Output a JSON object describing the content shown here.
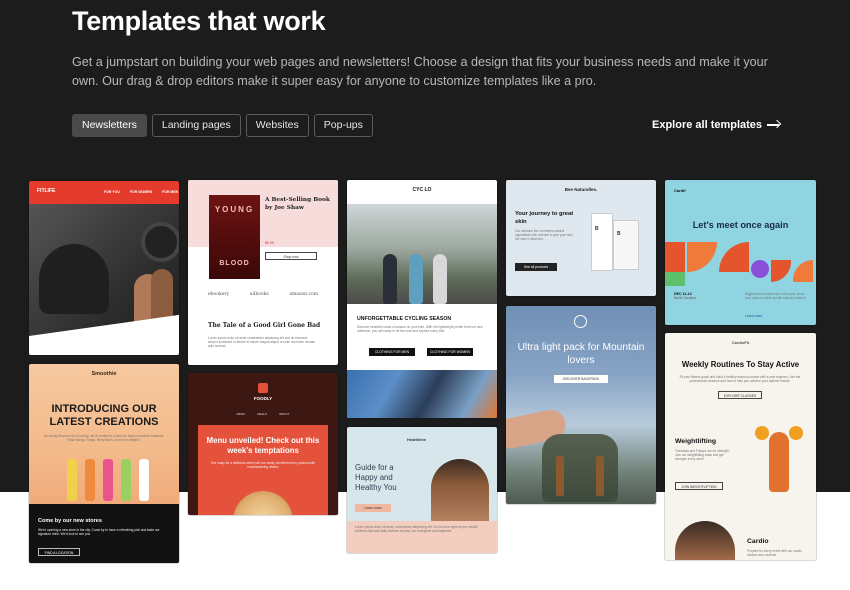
{
  "header": {
    "title": "Templates that work",
    "description": "Get a jumpstart on building your web pages and newsletters! Choose a design that fits your business needs and make it your own. Our drag & drop editors make it super easy for anyone to customize templates like a pro."
  },
  "tabs": [
    {
      "label": "Newsletters",
      "active": true
    },
    {
      "label": "Landing pages",
      "active": false
    },
    {
      "label": "Websites",
      "active": false
    },
    {
      "label": "Pop-ups",
      "active": false
    }
  ],
  "explore_link": "Explore all templates",
  "templates": {
    "fitlife": {
      "brand": "FITLIFE",
      "nav": [
        "FOR YOU",
        "FOR WOMEN",
        "FOR MEN"
      ]
    },
    "smoothie": {
      "brand": "Smoothie",
      "headline": "INTRODUCING OUR LATEST CREATIONS",
      "body": "As spring blooms into full swing, we're excited to unveil our latest smoothie creations: Rose Mango Tango, Berry Bash, and more delights.",
      "footer_title": "Come by our new stores",
      "footer_body": "We're opening a new store in the city. Come by to have a refreshing pick and taste our signature drink. We'd love to see you.",
      "button": "FIND A LOCATION"
    },
    "book": {
      "cover_top": "YOUNG",
      "cover_bottom": "BLOOD",
      "title": "A Best-Selling Book by Joe Shaw",
      "price": "$9.99",
      "button": "Shop now",
      "retailers": [
        "ebookery",
        "alibooks",
        "amazon.com"
      ],
      "section_title": "The Tale of a Good Girl Gone Bad",
      "body": "Lorem ipsum dolor sit amet consectetur adipiscing elit sed do eiusmod tempor incididunt ut labore et dolore magna aliqua ut enim ad minim veniam quis nostrud."
    },
    "foodly": {
      "brand": "FOODLY",
      "nav": [
        "MENU",
        "DEALS",
        "ABOUT"
      ],
      "headline": "Menu unveiled! Check out this week's temptations",
      "body": "Get ready for a delicious week with our newly unveiled menu, packed with mouthwatering dishes."
    },
    "cyclo": {
      "brand": "CYC LO",
      "headline": "UNFORGETTABLE CYCLING SEASON",
      "body": "Discover beautiful roads of season on your bike. With the lightweight profile from our new collection, you will ready to hit the road and explore every trail.",
      "button_men": "CLOTHING FOR MEN",
      "button_women": "CLOTHING FOR WOMEN"
    },
    "healthline": {
      "brand": "Healthline",
      "headline": "Guide for a Happy and Healthy You",
      "button": "Learn more",
      "footer": "Lorem ipsum dolor sit amet, consectetur adipiscing elit. Do not lose sight of your health, wellness tips and daily routines to keep you energized and balanced."
    },
    "bee": {
      "brand": "Bee Naturalles.",
      "headline": "Your journey to great skin",
      "body": "Our skincare line combines natural ingredients with science to give your skin the care it deserves.",
      "button": "See all products",
      "box_letter": "B"
    },
    "mountain": {
      "headline": "Ultra light pack for Mountain lovers",
      "button": "DISCOVER BACKPACK"
    },
    "cardif": {
      "brand": "Cardif",
      "headline": "Let's meet once again",
      "date": "DEC 11-14",
      "location": "North Carolina",
      "body": "Biggest tech conference in this year. Book your place to meet up with industry leaders.",
      "link": "Learn more"
    },
    "cardiofit": {
      "brand": "CardioFit",
      "headline": "Weekly Routines To Stay Active",
      "intro": "Fit your fitness goals and build a healthy workout routine with a new regimen. Use the professional coaches and how to help you achieve your optimal results.",
      "button1": "EXPLORE CLASSES",
      "section1_title": "Weightlifting",
      "section1_body": "Tuesdays and Fridays are for strength. Join our weightlifting class and get stronger every week.",
      "button2": "JOIN WEIGHTLIFTING",
      "section2_title": "Cardio",
      "section2_body": "Prepare for every event with our cardio classes and routines."
    }
  }
}
